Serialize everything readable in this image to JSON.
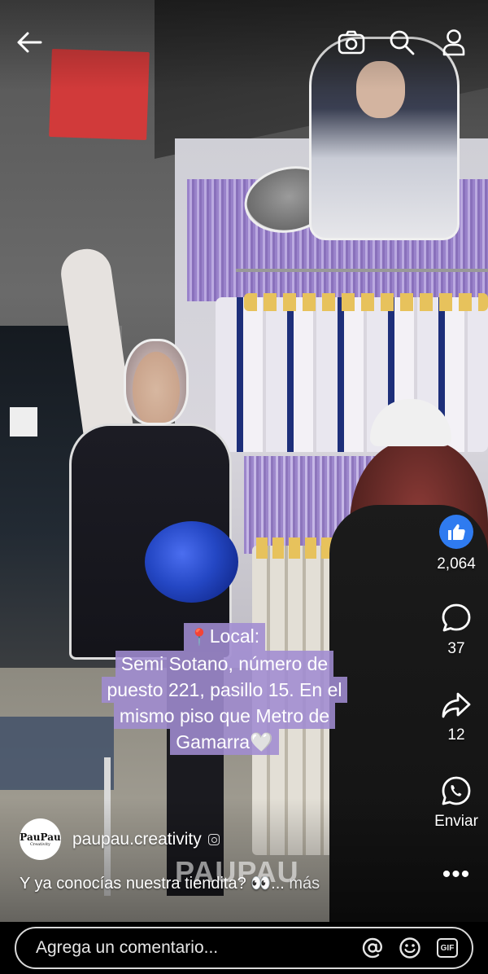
{
  "caption_sticker": {
    "line1": "Local:",
    "line2": "Semi Sotano, número de",
    "line3": "puesto 221, pasillo 15. En el",
    "line4": "mismo piso que Metro de",
    "line5": "Gamarra",
    "emoji_pin": "📍",
    "emoji_heart": "🤍"
  },
  "actions": {
    "like_count": "2,064",
    "comment_count": "37",
    "share_count": "12",
    "send_label": "Enviar",
    "more_label": "•••"
  },
  "author": {
    "avatar_text": "PauPau",
    "avatar_subtext": "Creativity",
    "name": "paupau.creativity"
  },
  "post": {
    "caption": "Y ya conocías nuestra tiendita? 👀... ",
    "more_link": "más"
  },
  "watermark": "PAUPAU",
  "comment_bar": {
    "placeholder": "Agrega un comentario...",
    "gif_label": "GIF"
  },
  "colors": {
    "like_blue": "#2f7bf0",
    "sticker_purple": "#a08cd2"
  },
  "icons": [
    "back-arrow-icon",
    "camera-icon",
    "search-icon",
    "profile-icon",
    "like-icon",
    "comment-icon",
    "share-icon",
    "whatsapp-icon",
    "more-icon",
    "at-icon",
    "emoji-icon",
    "gif-icon",
    "verified-icon"
  ]
}
